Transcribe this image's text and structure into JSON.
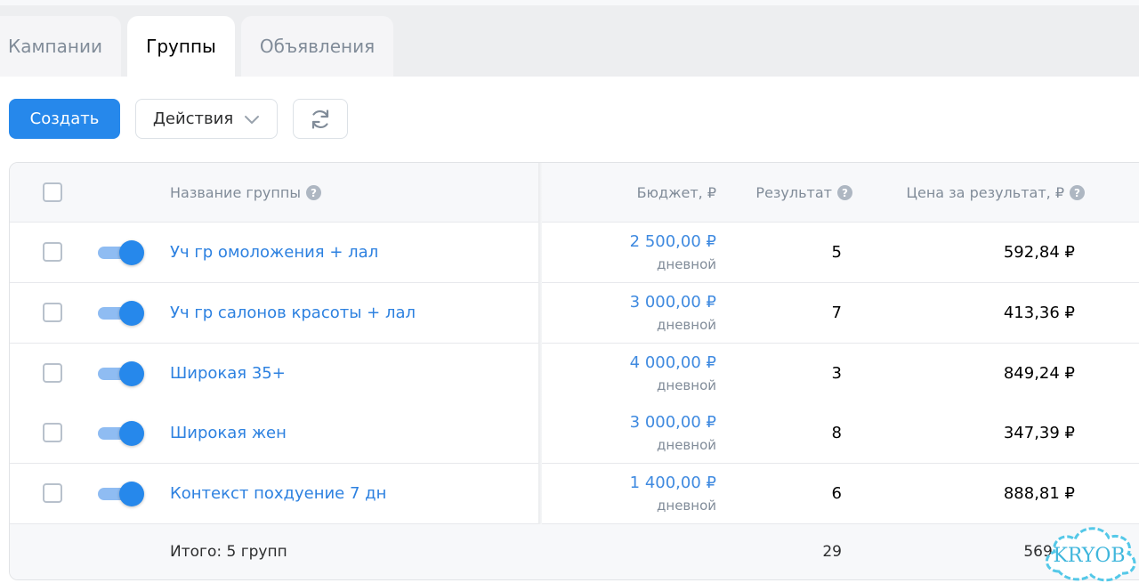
{
  "tabs": [
    {
      "label": "Кампании",
      "active": false
    },
    {
      "label": "Группы",
      "active": true
    },
    {
      "label": "Объявления",
      "active": false
    }
  ],
  "toolbar": {
    "create_label": "Создать",
    "actions_label": "Действия",
    "refresh_icon": "refresh-icon"
  },
  "table": {
    "headers": {
      "name": "Название группы",
      "budget": "Бюджет, ₽",
      "result": "Результат",
      "price": "Цена за результат, ₽"
    },
    "rows": [
      {
        "name": "Уч гр омоложения + лал",
        "budget": "2 500,00 ₽",
        "budget_type": "дневной",
        "result": "5",
        "price": "592,84 ₽",
        "enabled": true
      },
      {
        "name": "Уч гр салонов красоты + лал",
        "budget": "3 000,00 ₽",
        "budget_type": "дневной",
        "result": "7",
        "price": "413,36 ₽",
        "enabled": true
      },
      {
        "name": "Широкая 35+",
        "budget": "4 000,00 ₽",
        "budget_type": "дневной",
        "result": "3",
        "price": "849,24 ₽",
        "enabled": true
      },
      {
        "name": "Широкая жен",
        "budget": "3 000,00 ₽",
        "budget_type": "дневной",
        "result": "8",
        "price": "347,39 ₽",
        "enabled": true
      },
      {
        "name": "Контекст похдуение 7 дн",
        "budget": "1 400,00 ₽",
        "budget_type": "дневной",
        "result": "6",
        "price": "888,81 ₽",
        "enabled": true
      }
    ],
    "footer": {
      "label": "Итого: 5 групп",
      "result": "29",
      "price": "569,5"
    }
  },
  "watermark": {
    "text": "KRYOB"
  },
  "colors": {
    "accent": "#2688eb",
    "link": "#2d81e0",
    "muted": "#818c99"
  }
}
